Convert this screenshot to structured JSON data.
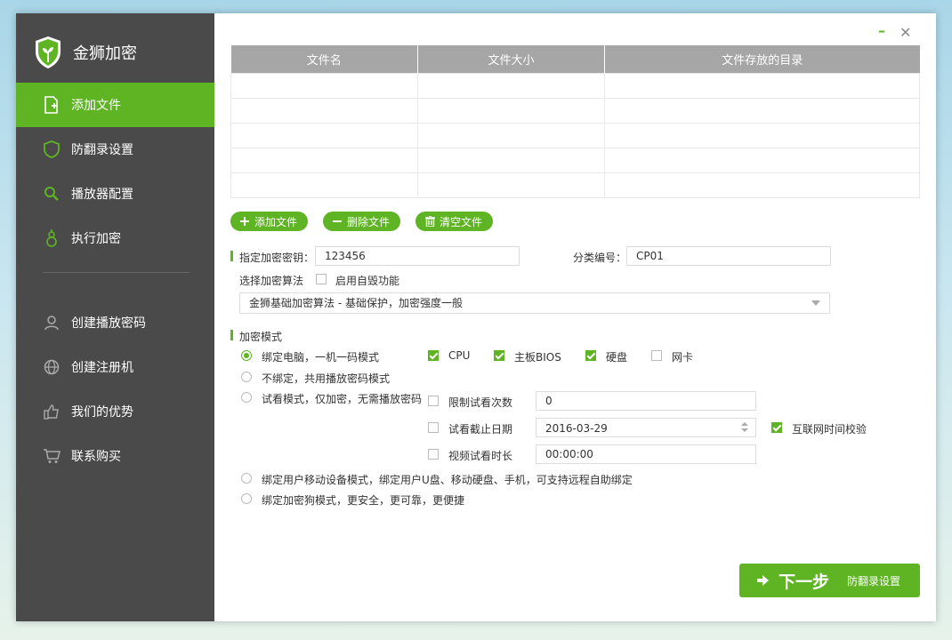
{
  "brand": {
    "name": "金狮加密"
  },
  "sidebar": {
    "items": [
      {
        "label": "添加文件",
        "icon": "file-add-icon",
        "active": true
      },
      {
        "label": "防翻录设置",
        "icon": "shield-icon"
      },
      {
        "label": "播放器配置",
        "icon": "search-icon"
      },
      {
        "label": "执行加密",
        "icon": "gourd-icon"
      },
      {
        "label": "创建播放密码",
        "icon": "user-icon"
      },
      {
        "label": "创建注册机",
        "icon": "globe-icon"
      },
      {
        "label": "我们的优势",
        "icon": "thumbs-up-icon"
      },
      {
        "label": "联系购买",
        "icon": "cart-icon"
      }
    ]
  },
  "window": {
    "minimize": "–",
    "close": "✕"
  },
  "files_table": {
    "headers": [
      "文件名",
      "文件大小",
      "文件存放的目录"
    ],
    "rows": [
      [
        "",
        "",
        ""
      ],
      [
        "",
        "",
        ""
      ],
      [
        "",
        "",
        ""
      ],
      [
        "",
        "",
        ""
      ],
      [
        "",
        "",
        ""
      ]
    ]
  },
  "file_actions": {
    "add": "添加文件",
    "delete": "删除文件",
    "clear": "清空文件"
  },
  "key": {
    "label": "指定加密密钥：",
    "value": "123456"
  },
  "category": {
    "label": "分类编号：",
    "value": "CP01"
  },
  "algorithm": {
    "label": "选择加密算法",
    "self_destruct_label": "启用自毁功能",
    "selected": "金狮基础加密算法 - 基础保护，加密强度一般"
  },
  "mode": {
    "label": "加密模式",
    "options": [
      "绑定电脑，一机一码模式",
      "不绑定，共用播放密码模式",
      "试看模式，仅加密，无需播放密码",
      "绑定用户移动设备模式，绑定用户U盘、移动硬盘、手机，可支持远程自助绑定",
      "绑定加密狗模式，更安全，更可靠，更便捷"
    ],
    "selected_index": 0,
    "hardware": [
      {
        "label": "CPU",
        "checked": true
      },
      {
        "label": "主板BIOS",
        "checked": true
      },
      {
        "label": "硬盘",
        "checked": true
      },
      {
        "label": "网卡",
        "checked": false
      }
    ],
    "trial": {
      "limit_count_label": "限制试看次数",
      "limit_count_value": "0",
      "end_date_label": "试看截止日期",
      "end_date_value": "2016-03-29",
      "internet_check_label": "互联网时间校验",
      "duration_label": "视频试看时长",
      "duration_value": "00:00:00"
    }
  },
  "next": {
    "big": "下一步",
    "small": "防翻录设置"
  },
  "colors": {
    "accent": "#5fb424",
    "sidebar": "#4a4a4a",
    "table_header": "#a6a6a6"
  }
}
